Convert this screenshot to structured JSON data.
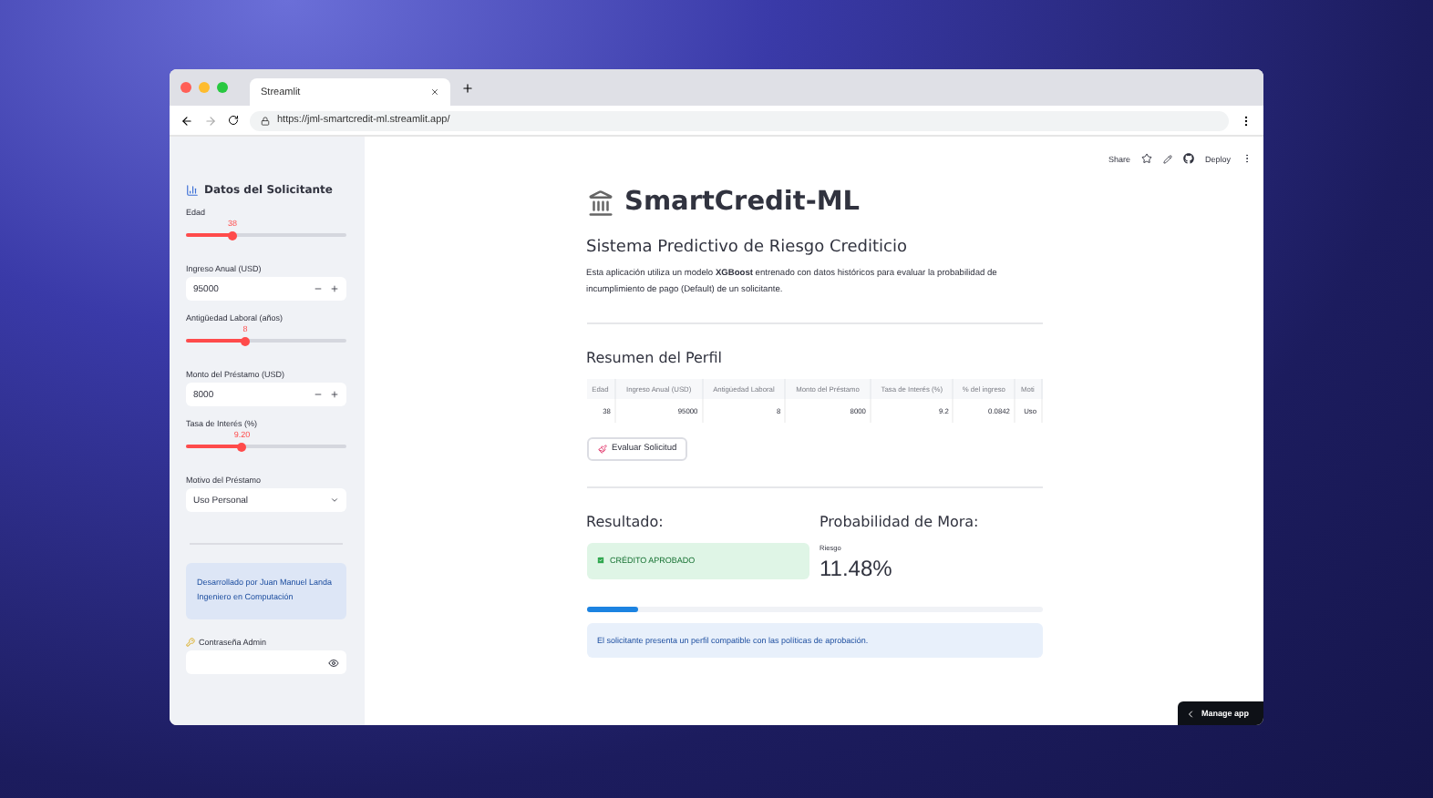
{
  "browser": {
    "tab_title": "Streamlit",
    "url": "https://jml-smartcredit-ml.streamlit.app/"
  },
  "toolbar": {
    "share": "Share",
    "deploy": "Deploy"
  },
  "sidebar": {
    "title": "Datos del Solicitante",
    "fields": [
      {
        "kind": "slider",
        "label": "Edad",
        "reading": "38",
        "level": 0.29
      },
      {
        "kind": "number",
        "label": "Ingreso Anual (USD)",
        "value": "95000"
      },
      {
        "kind": "slider",
        "label": "Antigüedad Laboral (años)",
        "reading": "8",
        "level": 0.37
      },
      {
        "kind": "number",
        "label": "Monto del Préstamo (USD)",
        "value": "8000"
      },
      {
        "kind": "slider",
        "label": "Tasa de Interés (%)",
        "reading": "9.20",
        "level": 0.35
      },
      {
        "kind": "select",
        "label": "Motivo del Préstamo",
        "value": "Uso Personal"
      }
    ],
    "credit": "Desarrollado por Juan Manuel Landa Ingeniero en Computación",
    "password_label": "Contraseña Admin"
  },
  "main": {
    "title": "SmartCredit-ML",
    "subtitle": "Sistema Predictivo de Riesgo Crediticio",
    "description": "Esta aplicación utiliza un modelo **XGBoost** entrenado con datos históricos para evaluar la probabilidad de incumplimiento de pago (Default) de un solicitante.",
    "summary_title": "Resumen del Perfil",
    "table": {
      "columns": [
        "Edad",
        "Ingreso Anual (USD)",
        "Antigüedad Laboral",
        "Monto del Préstamo",
        "Tasa de Interés (%)",
        "% del ingreso",
        "Moti"
      ],
      "rows": [
        [
          "38",
          "95000",
          "8",
          "8000",
          "9.2",
          "0.0842",
          "Uso"
        ]
      ]
    },
    "button": "Evaluar Solicitud",
    "result_title": "Resultado:",
    "result_status": "CRÉDITO APROBADO",
    "probability_title": "Probabilidad de Mora:",
    "probability_label": "Riesgo",
    "probability_value": "11.48%",
    "risk_bar": {
      "level": 0.1148
    },
    "message": "El solicitante presenta un perfil compatible con las políticas de aprobación."
  },
  "manage_app": "Manage app"
}
